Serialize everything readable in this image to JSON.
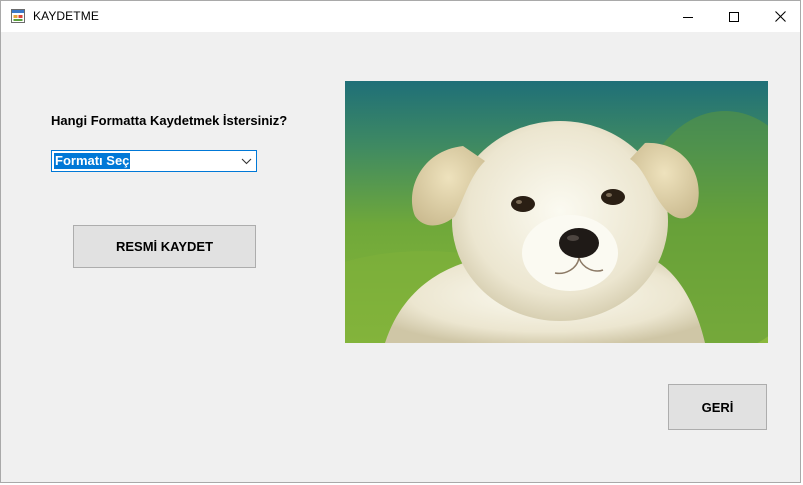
{
  "window": {
    "title": "KAYDETME",
    "icon": "form-icon",
    "controls": [
      "minimize-icon",
      "maximize-icon",
      "close-icon"
    ]
  },
  "form": {
    "question": "Hangi Formatta Kaydetmek İstersiniz?",
    "format_select": {
      "selected": "Formatı Seç",
      "icon": "chevron-down-icon"
    },
    "save_button": "RESMİ KAYDET",
    "back_button": "GERİ"
  },
  "picture": {
    "subject": "white puppy photo"
  },
  "colors": {
    "window_bg": "#f0f0f0",
    "titlebar_bg": "#ffffff",
    "selection": "#0078d7",
    "button_bg": "#e1e1e1",
    "button_border": "#adadad"
  }
}
